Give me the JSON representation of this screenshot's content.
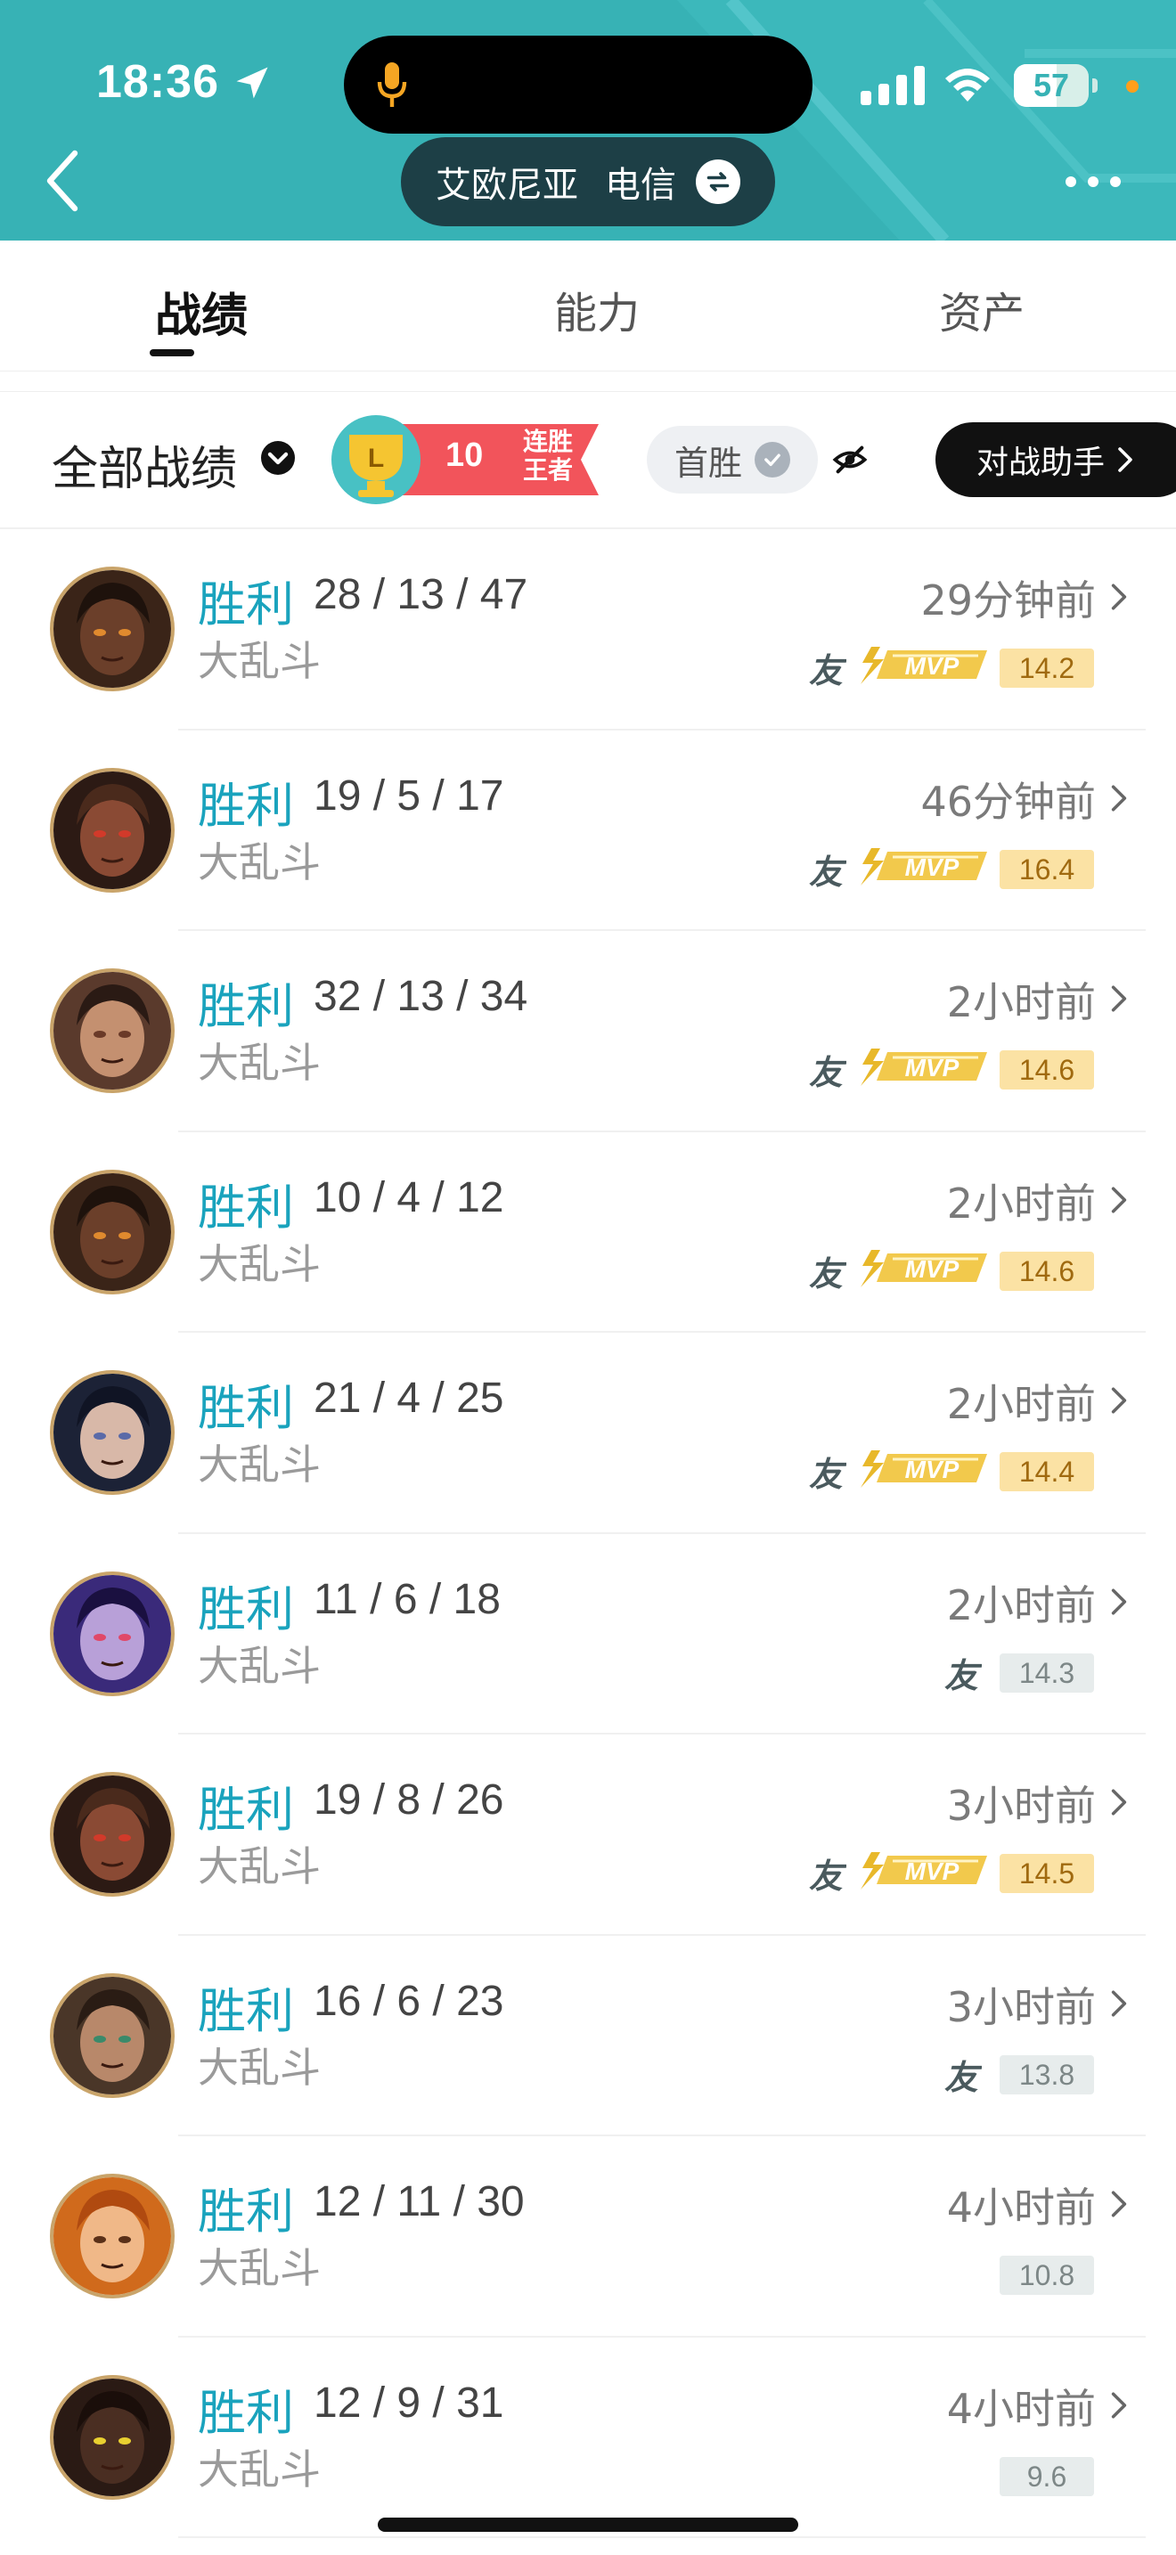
{
  "status_bar": {
    "time": "18:36",
    "battery": "57",
    "battery_level": 0.57
  },
  "header": {
    "server_region": "艾欧尼亚",
    "server_isp": "电信"
  },
  "tabs": [
    {
      "label": "战绩",
      "active": true
    },
    {
      "label": "能力",
      "active": false
    },
    {
      "label": "资产",
      "active": false
    }
  ],
  "filter": {
    "label": "全部战绩",
    "streak_count": "10",
    "streak_line1": "连胜",
    "streak_line2": "王者",
    "first_win_label": "首胜",
    "assist_label": "对战助手"
  },
  "icons": {
    "friend_glyph": "友",
    "mvp_text": "MVP",
    "streak_badge": "L"
  },
  "colors": {
    "header_bg": "#37b2b5",
    "win_text": "#1aa3bd",
    "streak_red": "#f2545b",
    "gold": "#e8b82a"
  },
  "matches": [
    {
      "result": "胜利",
      "kda": "28 / 13 / 47",
      "mode": "大乱斗",
      "time": "29分钟前",
      "score": "14.2",
      "mvp": true,
      "friend": true,
      "hero": "hero-dark-skin"
    },
    {
      "result": "胜利",
      "kda": "19 / 5 / 17",
      "mode": "大乱斗",
      "time": "46分钟前",
      "score": "16.4",
      "mvp": true,
      "friend": true,
      "hero": "hero-monkey"
    },
    {
      "result": "胜利",
      "kda": "32 / 13 / 34",
      "mode": "大乱斗",
      "time": "2小时前",
      "score": "14.6",
      "mvp": true,
      "friend": true,
      "hero": "hero-man"
    },
    {
      "result": "胜利",
      "kda": "10 / 4 / 12",
      "mode": "大乱斗",
      "time": "2小时前",
      "score": "14.6",
      "mvp": true,
      "friend": true,
      "hero": "hero-dark-skin"
    },
    {
      "result": "胜利",
      "kda": "21 / 4 / 25",
      "mode": "大乱斗",
      "time": "2小时前",
      "score": "14.4",
      "mvp": true,
      "friend": true,
      "hero": "hero-hat-woman"
    },
    {
      "result": "胜利",
      "kda": "11 / 6 / 18",
      "mode": "大乱斗",
      "time": "2小时前",
      "score": "14.3",
      "mvp": false,
      "friend": true,
      "hero": "hero-purple"
    },
    {
      "result": "胜利",
      "kda": "19 / 8 / 26",
      "mode": "大乱斗",
      "time": "3小时前",
      "score": "14.5",
      "mvp": true,
      "friend": true,
      "hero": "hero-monkey"
    },
    {
      "result": "胜利",
      "kda": "16 / 6 / 23",
      "mode": "大乱斗",
      "time": "3小时前",
      "score": "13.8",
      "mvp": false,
      "friend": true,
      "hero": "hero-woman"
    },
    {
      "result": "胜利",
      "kda": "12 / 11 / 30",
      "mode": "大乱斗",
      "time": "4小时前",
      "score": "10.8",
      "mvp": false,
      "friend": false,
      "hero": "hero-orange"
    },
    {
      "result": "胜利",
      "kda": "12 / 9 / 31",
      "mode": "大乱斗",
      "time": "4小时前",
      "score": "9.6",
      "mvp": false,
      "friend": false,
      "hero": "hero-dark-monster"
    }
  ]
}
